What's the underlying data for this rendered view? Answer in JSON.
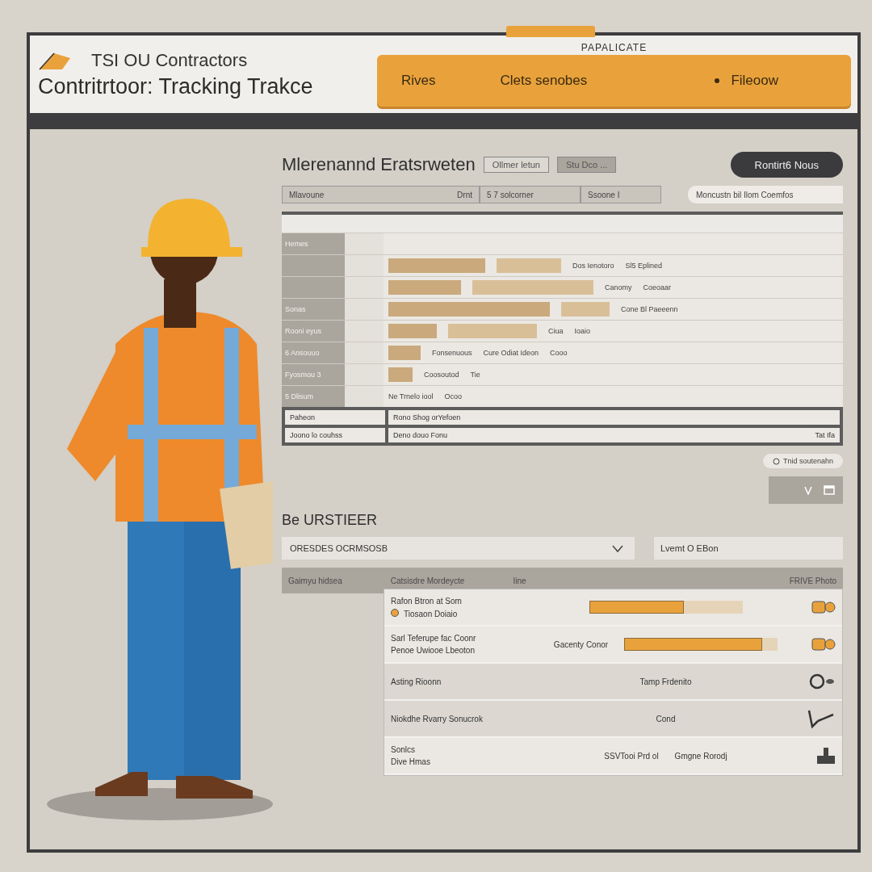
{
  "header": {
    "brand": "TSI OU Contractors",
    "title": "Contritrtoor: Tracking Trakce",
    "tab": "PAPALICATE",
    "nav": [
      {
        "label": "Rives"
      },
      {
        "label": "Clets senobes"
      },
      {
        "label": "Fileoow",
        "bullet": true
      }
    ]
  },
  "overview": {
    "title": "Mlerenannd Eratsrweten",
    "filters": [
      "Ollmer letun",
      "Stu Dco ..."
    ],
    "button": "Rontirt6 Nous",
    "fields": [
      {
        "value": "Mlavoune",
        "extra": "Drnt"
      },
      {
        "value": "5 7 solcorner"
      },
      {
        "value": "Ssoone I"
      }
    ],
    "search": {
      "placeholder": "Moncustn bil Ilom Coemfos"
    }
  },
  "schedule": {
    "header": "Hemes",
    "lanes": [
      {
        "tasks": [
          "Dos Ienotoro",
          "Sl5 Eplined"
        ]
      },
      {
        "tasks": [
          "Canomy",
          "Coeoaar"
        ]
      },
      {
        "label": "Sonas",
        "tasks": [
          "Cone Bl Paeeenn"
        ]
      },
      {
        "label": "Rooni eyus",
        "tasks": [
          "Ciua",
          "Ioaio"
        ]
      },
      {
        "label": "6 Ansouuo",
        "tasks": [
          "Fonsenuous",
          "Cure Odiat Ideon",
          "Cooo"
        ]
      },
      {
        "label": "Fyosmou 3",
        "tasks": [
          "Coosoutod",
          "Tie"
        ]
      },
      {
        "label": "5 Dlisum",
        "tasks": [
          "Ne Trnelo iool",
          "Ocoo"
        ]
      }
    ],
    "footer": [
      {
        "label": "Paheon",
        "value": "Rono Shog orYefoen"
      },
      {
        "label": "Joono lo couhss",
        "value": "Deno douo Fonu",
        "extra": "Tat Ifa"
      }
    ],
    "pill": "Tnid soutenahn"
  },
  "details": {
    "title": "Be URSTIEER",
    "select": "ORESDES OCRMSOSB",
    "input": "Lvemt O EBon",
    "columns": [
      "Gaimyu hidsea",
      "Catsisdre Mordeycte",
      "Iine",
      "FRIVE Photo"
    ],
    "rows": [
      {
        "kind": "bar",
        "title": "Rafon Btron at Som",
        "subtitle": "Tiosaon Doiaio",
        "level": 0.62,
        "shaded": false
      },
      {
        "kind": "bar",
        "title": "Sarl Teferupe fac Coonr",
        "subtitle": "Penoe Uwiooe Lbeoton",
        "status": "Gacenty Conor",
        "level": 0.9,
        "shaded": false
      },
      {
        "kind": "search",
        "title": "Asting Rioonn",
        "status": "Tamp Frdenito",
        "shaded": true
      },
      {
        "kind": "check",
        "title": "Niokdhe Rvarry Sonucrok",
        "status": "Cond",
        "shaded": true
      },
      {
        "kind": "stamp",
        "title": "Sonlcs",
        "subtitle": "Dive Hmas",
        "note": "SSVTooi Prd ol",
        "status": "Gmgne Rorodj",
        "shaded": false
      }
    ]
  }
}
